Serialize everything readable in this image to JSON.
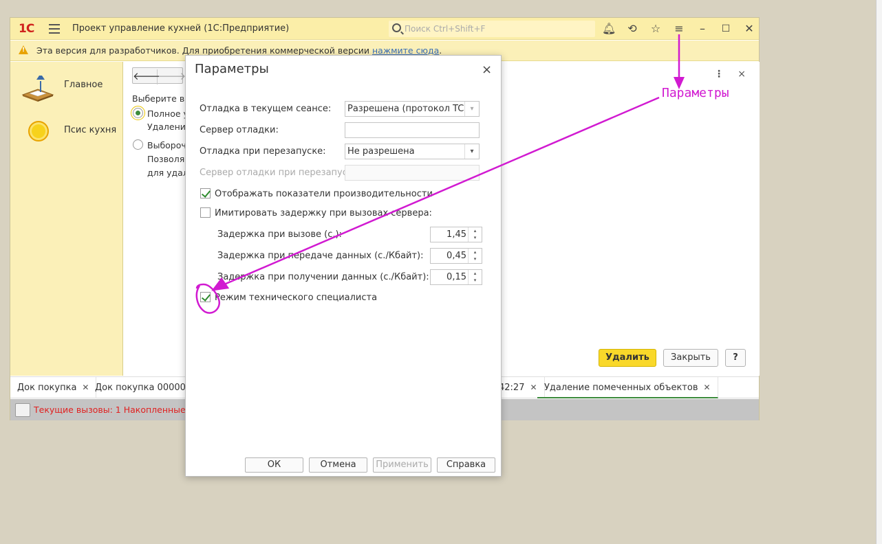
{
  "app": {
    "logo": "1С",
    "title": "Проект управление кухней  (1С:Предприятие)",
    "search_placeholder": "Поиск Ctrl+Shift+F"
  },
  "notice": {
    "text": "Эта версия для разработчиков. Для приобретения коммерческой версии ",
    "link": "нажмите сюда",
    "tail": "."
  },
  "sidebar": {
    "items": [
      {
        "label": "Главное",
        "icon": "desk-lamp-icon"
      },
      {
        "label": "Псис кухня",
        "icon": "sun-icon"
      }
    ]
  },
  "content": {
    "prompt": "Выберите ва",
    "option1_line1": "Полное у",
    "option1_line2": "Удаление",
    "option2_line1": "Выбороч",
    "option2_line2": "Позволя",
    "option2_line3": "для удал",
    "delete_button": "Удалить",
    "close_button": "Закрыть",
    "help_button": "?",
    "more_icon": "⋮",
    "close_icon": "×"
  },
  "tabs": [
    {
      "label": "Док покупка",
      "active": false
    },
    {
      "label": "Док покупка 0000000",
      "active": false
    },
    {
      "label": "42:27",
      "active": false
    },
    {
      "label": "Удаление помеченных объектов",
      "active": true
    }
  ],
  "status": {
    "text": "Текущие вызовы: 1   Накопленные в"
  },
  "dialog": {
    "title": "Параметры",
    "close": "×",
    "debug_session_label": "Отладка в текущем сеансе:",
    "debug_session_value": "Разрешена (протокол TCP/",
    "debug_server_label": "Сервер отладки:",
    "debug_server_value": "",
    "debug_restart_label": "Отладка при перезапуске:",
    "debug_restart_value": "Не разрешена",
    "debug_server_restart_label": "Сервер отладки при перезапус...",
    "show_perf_label": "Отображать показатели производительности",
    "show_perf_checked": true,
    "simulate_delay_label": "Имитировать задержку при вызовах сервера:",
    "simulate_delay_checked": false,
    "call_delay_label": "Задержка при вызове (с.):",
    "call_delay_value": "1,45",
    "send_delay_label": "Задержка при передаче данных (с./Кбайт):",
    "send_delay_value": "0,45",
    "recv_delay_label": "Задержка при получении данных (с./Кбайт):",
    "recv_delay_value": "0,15",
    "tech_mode_label": "Режим технического специалиста",
    "tech_mode_checked": true,
    "ok": "ОК",
    "cancel": "Отмена",
    "apply": "Применить",
    "help": "Справка"
  },
  "annotation": {
    "label": "Параметры",
    "color": "#d11ad1"
  }
}
